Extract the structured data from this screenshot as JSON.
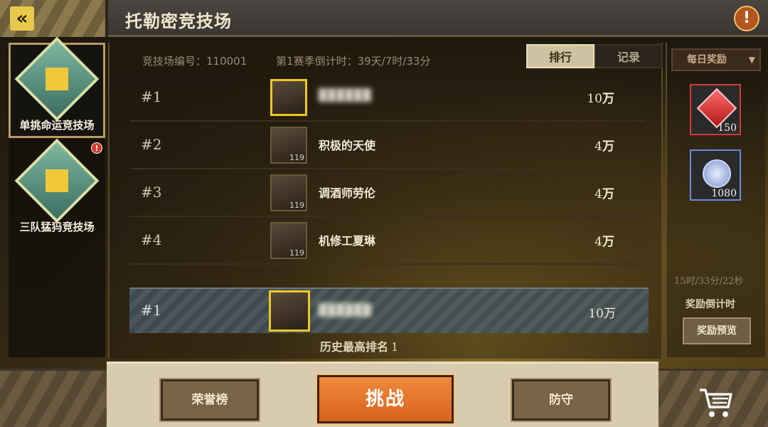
{
  "header": {
    "title": "托勒密竞技场",
    "back_icon": "chevron-left-double-icon",
    "info_icon": "exclamation-icon",
    "info_symbol": "!"
  },
  "sidebar": {
    "items": [
      {
        "label": "单挑命运竞技场",
        "icon": "arena-emblem-icon",
        "active": true
      },
      {
        "label": "三队猛犸竞技场",
        "icon": "arena-emblem-icon",
        "active": false,
        "alert": "!"
      }
    ]
  },
  "main": {
    "arena_id_label": "竞技场编号：110001",
    "season_label": "第1赛季倒计时：39天/7时/33分",
    "tabs": [
      {
        "label": "排行",
        "active": true
      },
      {
        "label": "记录",
        "active": false
      }
    ],
    "rows": [
      {
        "rank": "#1",
        "name": "",
        "level": "",
        "power_num": "10",
        "power_unit": "万",
        "blurred": true
      },
      {
        "rank": "#2",
        "name": "积极的天使",
        "level": "119",
        "power_num": "4",
        "power_unit": "万",
        "blurred": false
      },
      {
        "rank": "#3",
        "name": "调酒师劳伦",
        "level": "119",
        "power_num": "4",
        "power_unit": "万",
        "blurred": false
      },
      {
        "rank": "#4",
        "name": "机修工夏琳",
        "level": "119",
        "power_num": "4",
        "power_unit": "万",
        "blurred": false
      }
    ],
    "self": {
      "rank": "#1",
      "name": "",
      "power": "10万"
    },
    "history_label": "历史最高排名",
    "history_value": "1"
  },
  "right": {
    "daily_label": "每日奖励",
    "rewards": [
      {
        "icon": "red-gem-icon",
        "qty": "150"
      },
      {
        "icon": "silver-medal-icon",
        "qty": "1080"
      }
    ],
    "timer": "15时/33分/22秒",
    "timer_label": "奖励倒计时",
    "preview_label": "奖励预览"
  },
  "bottom": {
    "honor_label": "荣誉榜",
    "challenge_label": "挑战",
    "defense_label": "防守",
    "cart_icon": "shopping-cart-icon"
  },
  "colors": {
    "accent_orange": "#e07028",
    "gold": "#ecc825",
    "reward_red": "#d83838",
    "reward_blue": "#6a8ae0"
  }
}
